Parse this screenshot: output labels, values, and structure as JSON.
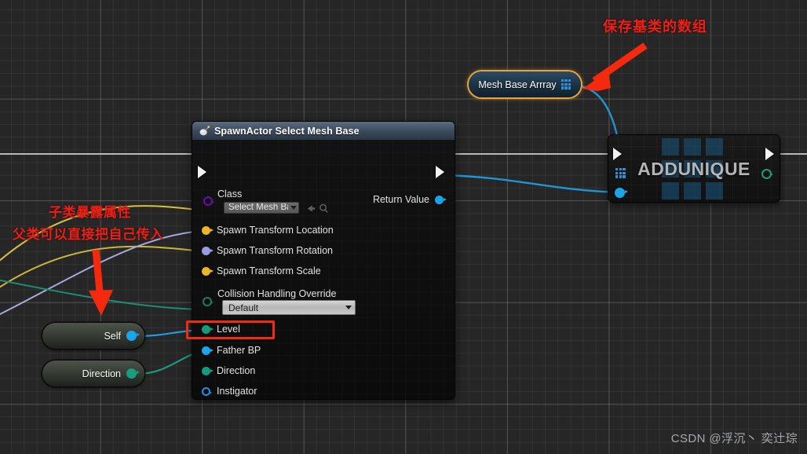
{
  "app": {
    "kind": "unreal-blueprint-graph",
    "background_color": "#262626",
    "grid_color": "#3a3a3a"
  },
  "spawn_node": {
    "title": "SpawnActor Select Mesh Base",
    "header_icon": "spawn-actor-icon",
    "exec_in": "exec-in-pin",
    "exec_out": "exec-out-pin",
    "class_label": "Class",
    "class_value": "Select Mesh Bas",
    "class_pin_color": "#6a0dad",
    "browse_icon": "back-arrow-icon",
    "search_icon": "magnifier-icon",
    "return_label": "Return Value",
    "return_pin_color": "#17a5e8",
    "collision_label": "Collision Handling Override",
    "collision_value": "Default",
    "collision_pin_color": "#1f7a63",
    "collapse_icon": "chevron-down-icon",
    "pins": [
      {
        "label": "Spawn Transform Location",
        "color": "#f0b429",
        "shape": "filled"
      },
      {
        "label": "Spawn Transform Rotation",
        "color": "#9a9ce8",
        "shape": "filled"
      },
      {
        "label": "Spawn Transform Scale",
        "color": "#f0b429",
        "shape": "filled"
      },
      {
        "label": "Level",
        "color": "#159a7d",
        "shape": "filled"
      },
      {
        "label": "Father BP",
        "color": "#19a6ec",
        "shape": "filled"
      },
      {
        "label": "Direction",
        "color": "#159a7d",
        "shape": "filled"
      },
      {
        "label": "Instigator",
        "color": "#1e90e8",
        "shape": "hollow"
      }
    ]
  },
  "mesh_array_node": {
    "label": "Mesh Base Arrray",
    "array_icon": "array-grid-icon",
    "highlight_color": "#e8a33d"
  },
  "addunique_node": {
    "title": "ADDUNIQUE",
    "watermark_icon": "array-grid-watermark",
    "exec_in": "exec-in-pin",
    "exec_out": "exec-out-pin",
    "array_pin_color": "#2e8fd4",
    "item_pin_color": "#19a6ec",
    "return_pin_color": "#1f9e72"
  },
  "var_nodes": [
    {
      "label": "Self",
      "pin_color": "#19a6ec"
    },
    {
      "label": "Direction",
      "pin_color": "#1a9d7e"
    }
  ],
  "annotations": {
    "top_right": "保存基类的数组",
    "left_line1": "子类暴露属性",
    "left_line2": "父类可以直接把自己传入",
    "arrow_color": "#f5290d",
    "highlight_box": "father-bp-highlight"
  },
  "watermark": "CSDN @浮沉丶 奕辻琮"
}
